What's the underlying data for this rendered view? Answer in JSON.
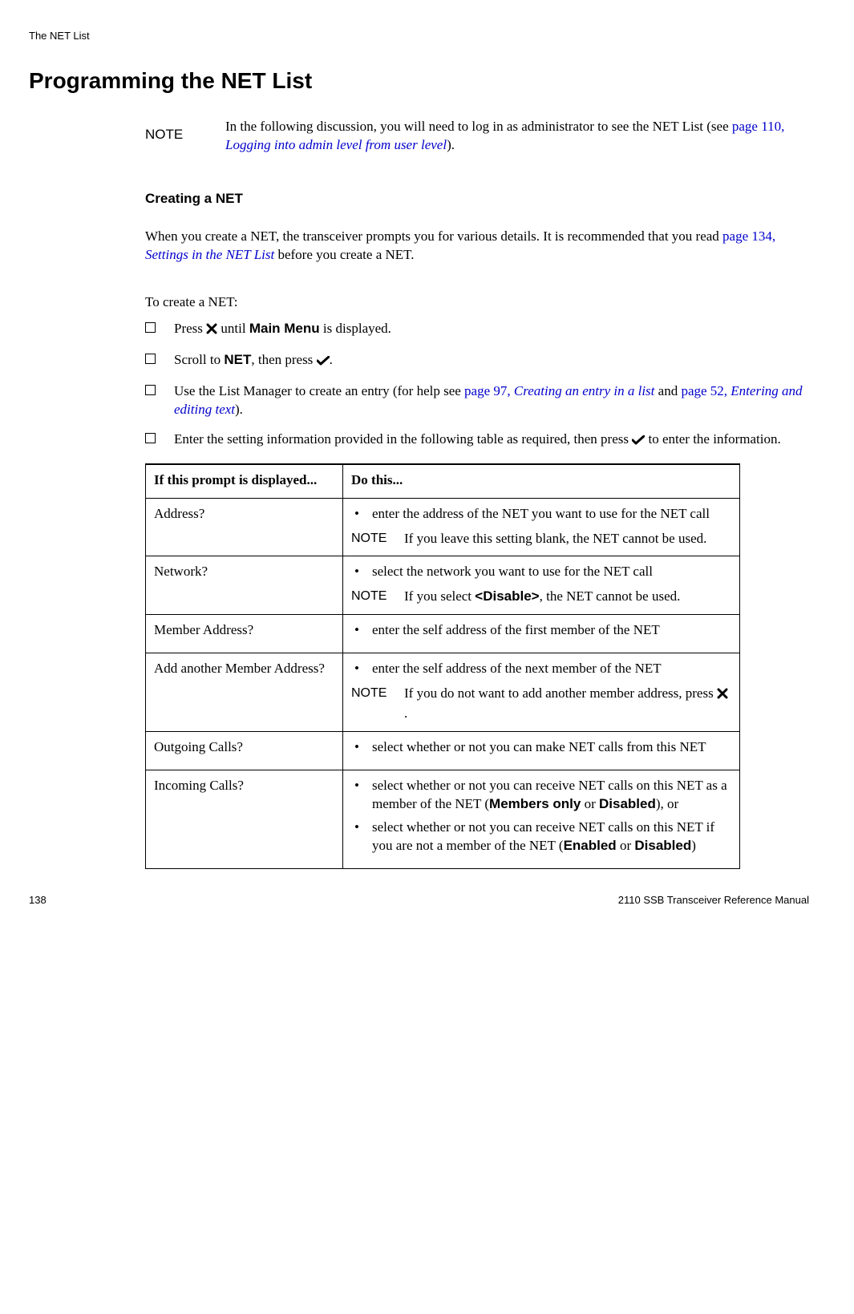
{
  "running_head": "The NET List",
  "title": "Programming the NET List",
  "intro_note": {
    "label": "NOTE",
    "text_a": "In the following discussion, you will need to log in as administrator to see the NET List (see ",
    "xref_page": "page 110, ",
    "xref_title": "Logging into admin level from user level",
    "text_b": ")."
  },
  "subhead": "Creating a NET",
  "body": {
    "p1_a": "When you create a NET, the transceiver prompts you for various details. It is recommended that you read ",
    "p1_xref_page": "page 134, ",
    "p1_xref_title": "Settings in the NET List",
    "p1_b": " before you create a NET."
  },
  "lead_in": "To create a NET:",
  "steps": {
    "s1_a": "Press ",
    "s1_b": " until ",
    "s1_bold": "Main Menu",
    "s1_c": " is displayed.",
    "s2_a": "Scroll to ",
    "s2_bold": "NET",
    "s2_b": ", then press ",
    "s2_c": ".",
    "s3_a": "Use the List Manager to create an entry (for help see ",
    "s3_x1_page": "page 97, ",
    "s3_x1_title": "Creating an entry in a list",
    "s3_mid": " and ",
    "s3_x2_page": "page 52, ",
    "s3_x2_title": "Entering and editing text",
    "s3_b": ").",
    "s4_a": "Enter the setting information provided in the following table as required, then press ",
    "s4_b": " to enter the information."
  },
  "table": {
    "h1": "If this prompt is displayed...",
    "h2": "Do this...",
    "rows": {
      "r1": {
        "prompt": "Address?",
        "bullet": "enter the address of the NET you want to use for the NET call",
        "note_label": "NOTE",
        "note_text": "If you leave this setting blank, the NET cannot be used."
      },
      "r2": {
        "prompt": "Network?",
        "bullet": "select the network you want to use for the NET call",
        "note_label": "NOTE",
        "note_a": "If you select ",
        "note_bold": "<Disable>",
        "note_b": ", the NET cannot be used."
      },
      "r3": {
        "prompt": "Member Address?",
        "bullet": "enter the self address of the first member of the NET"
      },
      "r4": {
        "prompt": "Add another Member Address?",
        "bullet": "enter the self address of the next member of the NET",
        "note_label": "NOTE",
        "note_a": "If you do not want to add another member address, press ",
        "note_b": "."
      },
      "r5": {
        "prompt": "Outgoing Calls?",
        "bullet": "select whether or not you can make NET calls from this NET"
      },
      "r6": {
        "prompt": "Incoming Calls?",
        "b1_a": "select whether or not you can receive NET calls on this NET as a member of the NET (",
        "b1_bold1": "Members only",
        "b1_mid": " or ",
        "b1_bold2": "Disabled",
        "b1_b": "), or",
        "b2_a": "select whether or not you can receive NET calls on this NET if you are not a member of the NET (",
        "b2_bold1": "Enabled",
        "b2_mid": " or ",
        "b2_bold2": "Disabled",
        "b2_b": ")"
      }
    }
  },
  "footer": {
    "page": "138",
    "doc": "2110 SSB Transceiver Reference Manual"
  }
}
